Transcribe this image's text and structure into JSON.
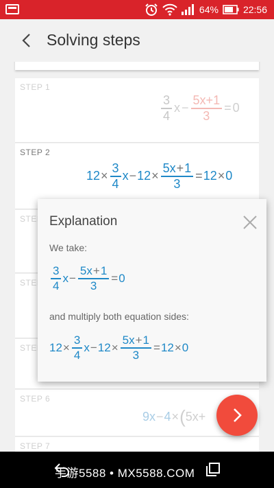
{
  "status_bar": {
    "battery": "64%",
    "time": "22:56"
  },
  "app_bar": {
    "title": "Solving steps"
  },
  "top_card_faded_text": "——————",
  "steps": [
    {
      "label": "STEP 1"
    },
    {
      "label": "STEP 2"
    },
    {
      "label": "STEP"
    },
    {
      "label": "STEP"
    },
    {
      "label": "STEP"
    },
    {
      "label": "STEP 6"
    },
    {
      "label": "STEP 7"
    }
  ],
  "math": {
    "n3": "3",
    "n4": "4",
    "x": "x",
    "minus": "−",
    "equals": "=",
    "zero": "0",
    "twelve": "12",
    "times": "×",
    "num_5x": "5x",
    "plus": "+",
    "one": "1",
    "nine_x": "9x",
    "four": "4",
    "paren": "(",
    "s5x_plus": "5x+"
  },
  "explanation": {
    "title": "Explanation",
    "text1": "We take:",
    "text2": "and multiply both equation sides:"
  },
  "watermark": "手游5588 • MX5588.COM",
  "colors": {
    "status_bar": "#d9232a",
    "accent_blue": "#1e88c7",
    "fab": "#f14b3c"
  }
}
